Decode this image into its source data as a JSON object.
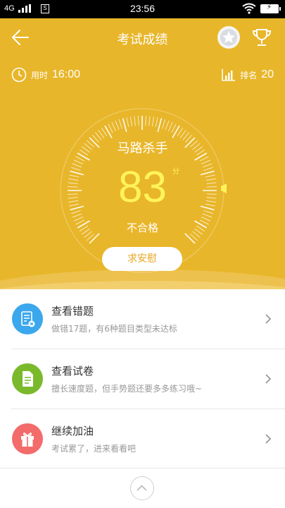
{
  "status_bar": {
    "network": "4G",
    "time": "23:56",
    "sim_label": "S"
  },
  "header": {
    "title": "考试成绩"
  },
  "stats": {
    "time_label": "用时",
    "time_value": "16:00",
    "rank_label": "排名",
    "rank_value": "20"
  },
  "result": {
    "title": "马路杀手",
    "score": "83",
    "unit": "分",
    "verdict": "不合格",
    "comfort_button": "求安慰"
  },
  "list": [
    {
      "title": "查看错题",
      "subtitle": "做错17题，有6种题目类型未达标",
      "icon": "wrong-questions-icon",
      "color": "#3ba7ec"
    },
    {
      "title": "查看试卷",
      "subtitle": "擅长速度题，但手势题还要多多练习哦~",
      "icon": "exam-paper-icon",
      "color": "#7ab92c"
    },
    {
      "title": "继续加油",
      "subtitle": "考试累了，进来看看吧",
      "icon": "gift-icon",
      "color": "#f36b6b"
    }
  ],
  "colors": {
    "hero": "#e8b62a",
    "score": "#fff45a",
    "button_text": "#e8a51f"
  }
}
